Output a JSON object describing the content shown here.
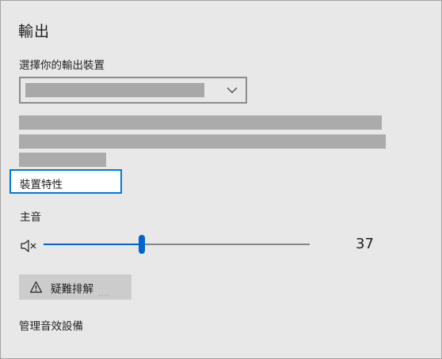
{
  "page": {
    "title": "輸出",
    "output_device_label": "選擇你的輸出裝置"
  },
  "device_properties": {
    "label": "裝置特性"
  },
  "volume": {
    "label": "主音",
    "value": "37",
    "level_percent": 37
  },
  "troubleshoot": {
    "label": "疑難排解",
    "trailing": "....",
    "icon": "warning-icon"
  },
  "manage": {
    "label": "管理音效設備"
  },
  "icons": {
    "dropdown": "chevron-down-icon",
    "speaker": "speaker-mute-icon"
  },
  "colors": {
    "accent": "#0064c8",
    "focus_border": "#0078d7",
    "background": "#e8e8e8"
  }
}
